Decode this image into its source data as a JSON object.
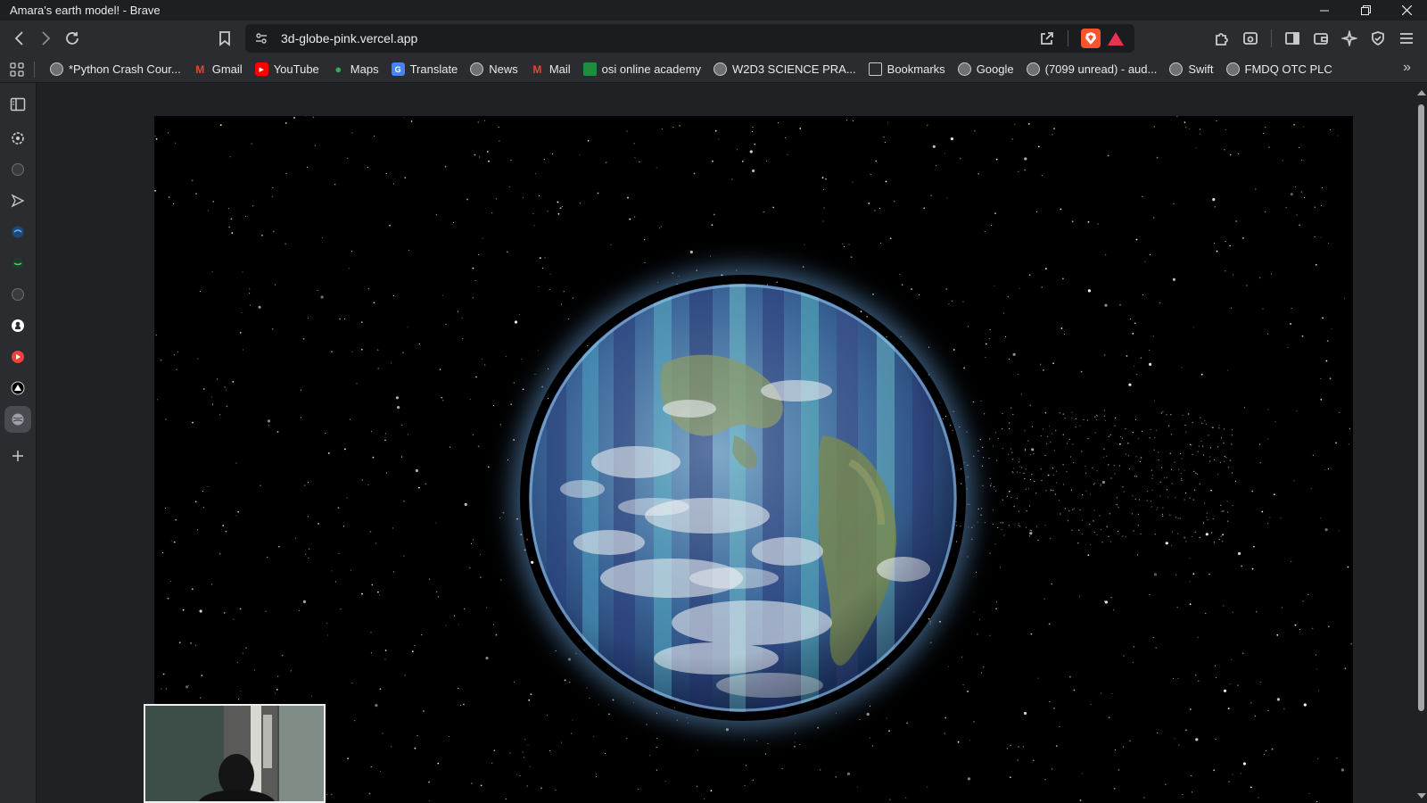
{
  "window": {
    "title": "Amara's earth model! - Brave",
    "controls": [
      "minimize",
      "restore",
      "close"
    ]
  },
  "toolbar": {
    "url": "3d-globe-pink.vercel.app",
    "icons": [
      "back-icon",
      "forward-icon",
      "reload-icon",
      "bookmark-icon",
      "site-settings-icon",
      "share-icon",
      "brave-shields-icon",
      "brave-rewards-icon",
      "extensions-icon",
      "tab-search-icon",
      "sidebar-toggle-icon",
      "wallet-icon",
      "leo-ai-icon",
      "vpn-icon",
      "menu-icon"
    ]
  },
  "bookmarks": [
    {
      "label": "*Python Crash Cour...",
      "icon": "globe-icon",
      "color": "#9aa0a6"
    },
    {
      "label": "Gmail",
      "icon": "gmail-icon",
      "color": "#ea4335"
    },
    {
      "label": "YouTube",
      "icon": "youtube-icon",
      "color": "#ff0000"
    },
    {
      "label": "Maps",
      "icon": "maps-icon",
      "color": "#34a853"
    },
    {
      "label": "Translate",
      "icon": "translate-icon",
      "color": "#4285f4"
    },
    {
      "label": "News",
      "icon": "globe-icon",
      "color": "#9aa0a6"
    },
    {
      "label": "Mail",
      "icon": "gmail-icon",
      "color": "#ea4335"
    },
    {
      "label": "osi online academy",
      "icon": "classroom-icon",
      "color": "#1e8e3e"
    },
    {
      "label": "W2D3 SCIENCE PRA...",
      "icon": "globe-icon",
      "color": "#9aa0a6"
    },
    {
      "label": "Bookmarks",
      "icon": "folder-icon",
      "color": "#9aa0a6"
    },
    {
      "label": "Google",
      "icon": "globe-icon",
      "color": "#9aa0a6"
    },
    {
      "label": "(7099 unread) - aud...",
      "icon": "globe-icon",
      "color": "#9aa0a6"
    },
    {
      "label": "Swift",
      "icon": "globe-icon",
      "color": "#9aa0a6"
    },
    {
      "label": "FMDQ OTC PLC",
      "icon": "globe-icon",
      "color": "#9aa0a6"
    }
  ],
  "sidebar": {
    "items": [
      "sidebar-panel-icon",
      "chatgpt-icon",
      "site-icon",
      "send-icon",
      "site-icon",
      "site-icon",
      "site-icon",
      "github-icon",
      "app-icon",
      "app-icon",
      "globe-icon",
      "add-icon"
    ]
  },
  "page": {
    "scene": "earth-globe-with-starfield",
    "webcam_overlay": "webcam-preview"
  }
}
